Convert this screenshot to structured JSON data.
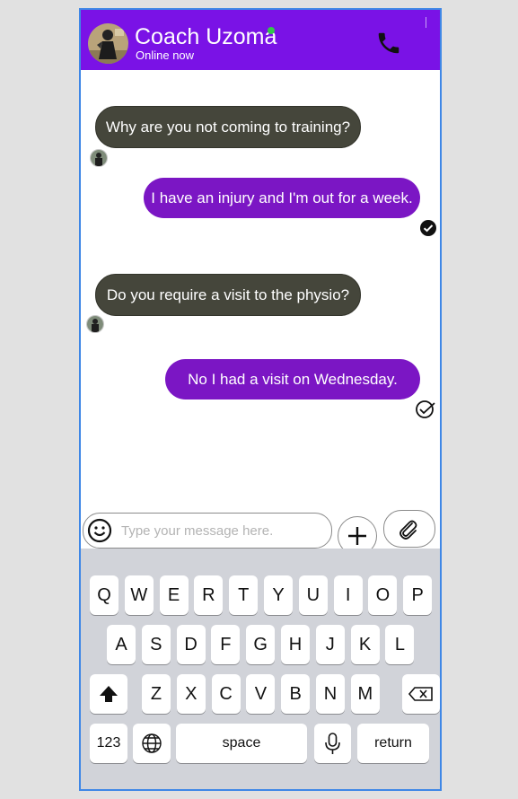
{
  "header": {
    "contact_name": "Coach Uzoma",
    "status": "Online now",
    "call_icon": "phone-icon",
    "online_color": "#33c64a",
    "bar_color": "#7a12e6"
  },
  "messages": [
    {
      "direction": "incoming",
      "text": "Why are you not coming to training?"
    },
    {
      "direction": "outgoing",
      "text": "I have an injury and I'm out for a week.",
      "status": "read"
    },
    {
      "direction": "incoming",
      "text": "Do you require a visit to the physio?"
    },
    {
      "direction": "outgoing",
      "text": "No I had a visit on Wednesday.",
      "status": "sent"
    }
  ],
  "composer": {
    "placeholder": "Type your message here.",
    "emoji_icon": "emoji-icon",
    "plus_icon": "plus-icon",
    "attach_icon": "paperclip-icon"
  },
  "keyboard": {
    "row1": [
      "Q",
      "W",
      "E",
      "R",
      "T",
      "Y",
      "U",
      "I",
      "O",
      "P"
    ],
    "row2": [
      "A",
      "S",
      "D",
      "F",
      "G",
      "H",
      "J",
      "K",
      "L"
    ],
    "row3": [
      "Z",
      "X",
      "C",
      "V",
      "B",
      "N",
      "M"
    ],
    "numbers_key": "123",
    "space_key": "space",
    "return_key": "return"
  }
}
